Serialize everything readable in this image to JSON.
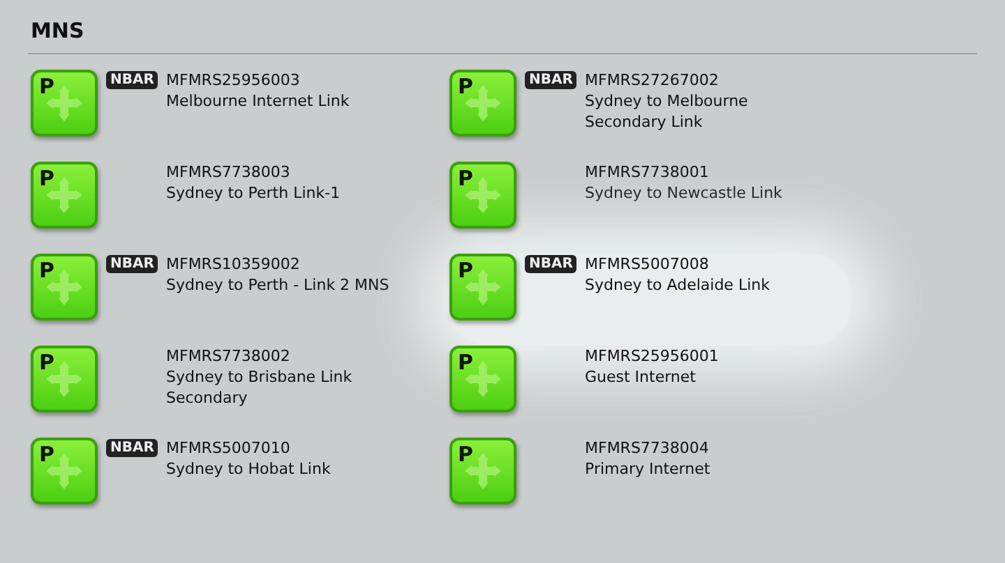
{
  "section": {
    "title": "MNS"
  },
  "links": [
    {
      "badge": "P",
      "nbar": "NBAR",
      "has_nbar": true,
      "id": "MFMRS25956003",
      "name": "Melbourne Internet Link",
      "highlighted": false
    },
    {
      "badge": "P",
      "nbar": "NBAR",
      "has_nbar": true,
      "id": "MFMRS27267002",
      "name": "Sydney to Melbourne Secondary Link",
      "highlighted": false
    },
    {
      "badge": "P",
      "has_nbar": false,
      "id": "MFMRS7738003",
      "name": "Sydney to Perth Link-1",
      "highlighted": false
    },
    {
      "badge": "P",
      "has_nbar": false,
      "id": "MFMRS7738001",
      "name": "Sydney to Newcastle Link",
      "highlighted": false
    },
    {
      "badge": "P",
      "nbar": "NBAR",
      "has_nbar": true,
      "id": "MFMRS10359002",
      "name": "Sydney to Perth - Link 2 MNS",
      "highlighted": false
    },
    {
      "badge": "P",
      "nbar": "NBAR",
      "has_nbar": true,
      "id": "MFMRS5007008",
      "name": "Sydney to Adelaide Link",
      "highlighted": true
    },
    {
      "badge": "P",
      "has_nbar": false,
      "id": "MFMRS7738002",
      "name": "Sydney to Brisbane Link Secondary",
      "highlighted": false
    },
    {
      "badge": "P",
      "has_nbar": false,
      "id": "MFMRS25956001",
      "name": "Guest Internet",
      "highlighted": false
    },
    {
      "badge": "P",
      "nbar": "NBAR",
      "has_nbar": true,
      "id": "MFMRS5007010",
      "name": "Sydney to Hobat Link",
      "highlighted": false
    },
    {
      "badge": "P",
      "has_nbar": false,
      "id": "MFMRS7738004",
      "name": "Primary Internet",
      "highlighted": false
    }
  ]
}
